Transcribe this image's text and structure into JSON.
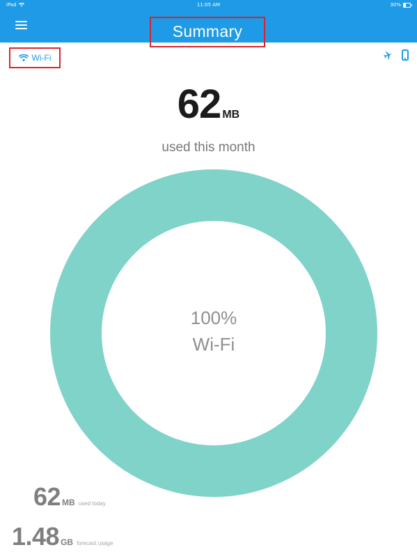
{
  "status_bar": {
    "device": "iPad",
    "time": "11:05 AM",
    "battery": "30%"
  },
  "header": {
    "title": "Summary",
    "menu_icon": "hamburger-menu-icon"
  },
  "tabs": {
    "wifi_label": "Wi-Fi",
    "wifi_icon": "wifi-icon",
    "right_icons": [
      "airplane-icon",
      "phone-icon"
    ]
  },
  "monthly": {
    "value": "62",
    "unit": "MB",
    "caption": "used this month"
  },
  "donut": {
    "percent_label": "100%",
    "network_label": "Wi-Fi",
    "wifi_fraction": 1.0,
    "color": "#7fd3c8"
  },
  "stats": {
    "today": {
      "value": "62",
      "unit": "MB",
      "label": "used today"
    },
    "forecast": {
      "value": "1.48",
      "unit": "GB",
      "label": "forecast usage"
    }
  },
  "colors": {
    "brand_blue": "#1e9ae6",
    "highlight_red": "#d8242d",
    "ring_teal": "#7fd3c8"
  }
}
